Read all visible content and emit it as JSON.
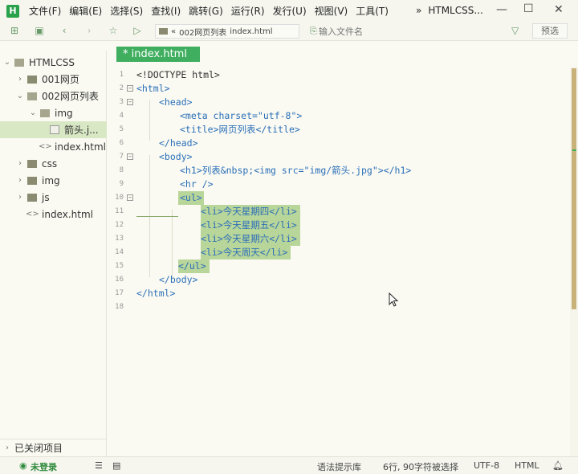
{
  "menu": {
    "items": [
      "文件(F)",
      "编辑(E)",
      "选择(S)",
      "查找(I)",
      "跳转(G)",
      "运行(R)",
      "发行(U)",
      "视图(V)",
      "工具(T)"
    ],
    "window_title": "HTMLCSS...",
    "chevron": "»"
  },
  "toolbar": {
    "breadcrumb_chev": "«",
    "breadcrumb_folder": "002网页列表",
    "breadcrumb_file": "index.html",
    "search_placeholder": "输入文件名",
    "preview_label": "预选"
  },
  "sidebar": {
    "items": [
      {
        "label": "HTMLCSS"
      },
      {
        "label": "001网页"
      },
      {
        "label": "002网页列表"
      },
      {
        "label": "img"
      },
      {
        "label": "箭头.j..."
      },
      {
        "label": "index.html"
      },
      {
        "label": "css"
      },
      {
        "label": "img"
      },
      {
        "label": "js"
      },
      {
        "label": "index.html"
      }
    ],
    "closed_projects": "已关闭项目"
  },
  "editor": {
    "tab_label": "* index.html",
    "lines": [
      {
        "n": "1",
        "text": "<!DOCTYPE html>"
      },
      {
        "n": "2",
        "text": "<html>"
      },
      {
        "n": "3",
        "text": "<head>"
      },
      {
        "n": "4",
        "text": "<meta charset=\"utf-8\">"
      },
      {
        "n": "5",
        "text": "<title>网页列表</title>"
      },
      {
        "n": "6",
        "text": "</head>"
      },
      {
        "n": "7",
        "text": "<body>"
      },
      {
        "n": "8",
        "text": "<h1>列表&nbsp;<img src=\"img/箭头.jpg\"></h1>"
      },
      {
        "n": "9",
        "text": "<hr />"
      },
      {
        "n": "10",
        "text": "<ul>"
      },
      {
        "n": "11",
        "text": "<li>今天星期四</li>"
      },
      {
        "n": "12",
        "text": "<li>今天星期五</li>"
      },
      {
        "n": "13",
        "text": "<li>今天星期六</li>"
      },
      {
        "n": "14",
        "text": "<li>今天周天</li>"
      },
      {
        "n": "15",
        "text": "</ul>"
      },
      {
        "n": "16",
        "text": "</body>"
      },
      {
        "n": "17",
        "text": "</html>"
      },
      {
        "n": "18",
        "text": ""
      }
    ]
  },
  "statusbar": {
    "login": "未登录",
    "syntax_hint": "语法提示库",
    "selection": "6行, 90字符被选择",
    "encoding": "UTF-8",
    "language": "HTML"
  }
}
